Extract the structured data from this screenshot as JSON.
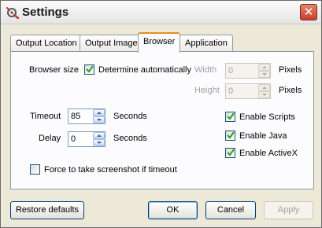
{
  "window": {
    "title": "Settings"
  },
  "tabs": [
    {
      "label": "Output Location",
      "active": false
    },
    {
      "label": "Output Image",
      "active": false
    },
    {
      "label": "Browser",
      "active": true
    },
    {
      "label": "Application",
      "active": false
    }
  ],
  "browser_size": {
    "label": "Browser size",
    "auto_checkbox": {
      "label": "Determine automatically",
      "checked": true
    },
    "width": {
      "label": "Width",
      "value": "0",
      "unit": "Pixels",
      "enabled": false
    },
    "height": {
      "label": "Height",
      "value": "0",
      "unit": "Pixels",
      "enabled": false
    }
  },
  "timeout": {
    "label": "Timeout",
    "value": "85",
    "unit": "Seconds"
  },
  "delay": {
    "label": "Delay",
    "value": "0",
    "unit": "Seconds"
  },
  "options": {
    "enable_scripts": {
      "label": "Enable Scripts",
      "checked": true
    },
    "enable_java": {
      "label": "Enable Java",
      "checked": true
    },
    "enable_activex": {
      "label": "Enable ActiveX",
      "checked": true
    },
    "force_screenshot": {
      "label": "Force to take screenshot if timeout",
      "checked": false
    }
  },
  "buttons": {
    "restore": "Restore defaults",
    "ok": "OK",
    "cancel": "Cancel",
    "apply": "Apply"
  },
  "colors": {
    "check": "#21a121",
    "close": "#c4402a",
    "tab_highlight": "#e68b2c"
  },
  "icons": {
    "app": "settings-app-icon",
    "close": "close-icon"
  }
}
